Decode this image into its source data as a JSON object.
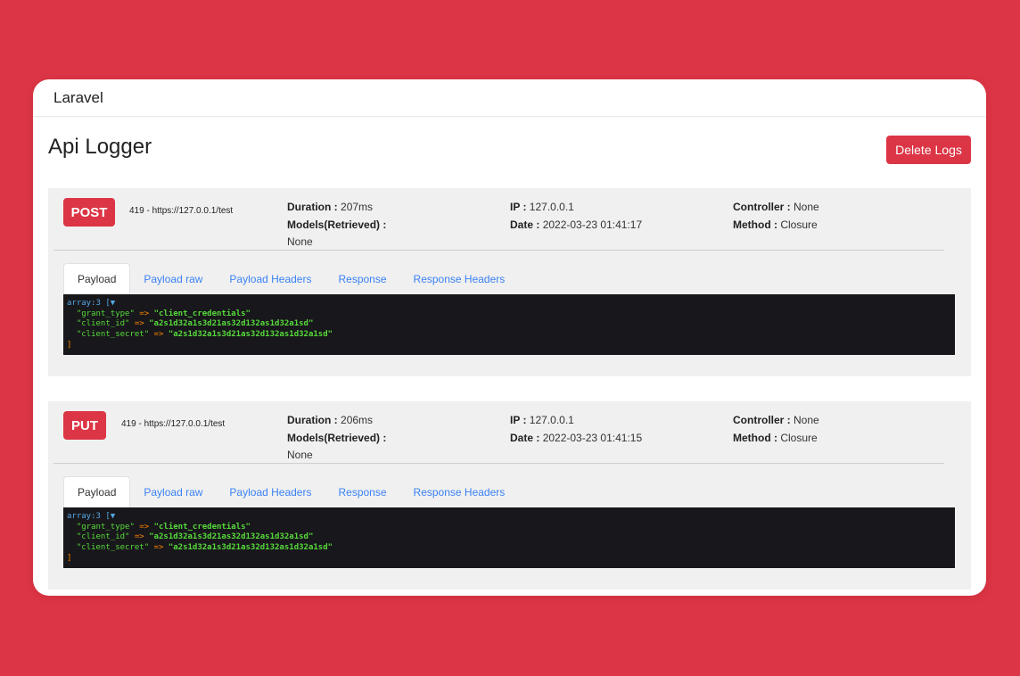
{
  "app": {
    "brand": "Laravel"
  },
  "page": {
    "title": "Api Logger",
    "delete_label": "Delete Logs"
  },
  "labels": {
    "duration": "Duration :",
    "models": "Models(Retrieved) :",
    "ip": "IP :",
    "date": "Date :",
    "controller": "Controller :",
    "method": "Method :"
  },
  "logs": [
    {
      "method": "POST",
      "url": "419 - https://127.0.0.1/test",
      "duration": "207ms",
      "models": "None",
      "ip": "127.0.0.1",
      "date": "2022-03-23 01:41:17",
      "controller": "None",
      "route_method": "Closure",
      "tabs": [
        "Payload",
        "Payload raw",
        "Payload Headers",
        "Response",
        "Response Headers"
      ],
      "payload": {
        "header": "array:3",
        "toggle": "[▼",
        "rows": [
          {
            "key": "\"grant_type\"",
            "arrow": "=>",
            "value": "\"client_credentials\""
          },
          {
            "key": "\"client_id\"",
            "arrow": "=>",
            "value": "\"a2s1d32a1s3d21as32d132as1d32a1sd\""
          },
          {
            "key": "\"client_secret\"",
            "arrow": "=>",
            "value": "\"a2s1d32a1s3d21as32d132as1d32a1sd\""
          }
        ],
        "close": "]"
      }
    },
    {
      "method": "PUT",
      "url": "419 - https://127.0.0.1/test",
      "duration": "206ms",
      "models": "None",
      "ip": "127.0.0.1",
      "date": "2022-03-23 01:41:15",
      "controller": "None",
      "route_method": "Closure",
      "tabs": [
        "Payload",
        "Payload raw",
        "Payload Headers",
        "Response",
        "Response Headers"
      ],
      "payload": {
        "header": "array:3",
        "toggle": "[▼",
        "rows": [
          {
            "key": "\"grant_type\"",
            "arrow": "=>",
            "value": "\"client_credentials\""
          },
          {
            "key": "\"client_id\"",
            "arrow": "=>",
            "value": "\"a2s1d32a1s3d21as32d132as1d32a1sd\""
          },
          {
            "key": "\"client_secret\"",
            "arrow": "=>",
            "value": "\"a2s1d32a1s3d21as32d132as1d32a1sd\""
          }
        ],
        "close": "]"
      }
    }
  ],
  "colors": {
    "accent": "#dc3545",
    "link": "#3b82f6",
    "code_bg": "#18171b"
  }
}
